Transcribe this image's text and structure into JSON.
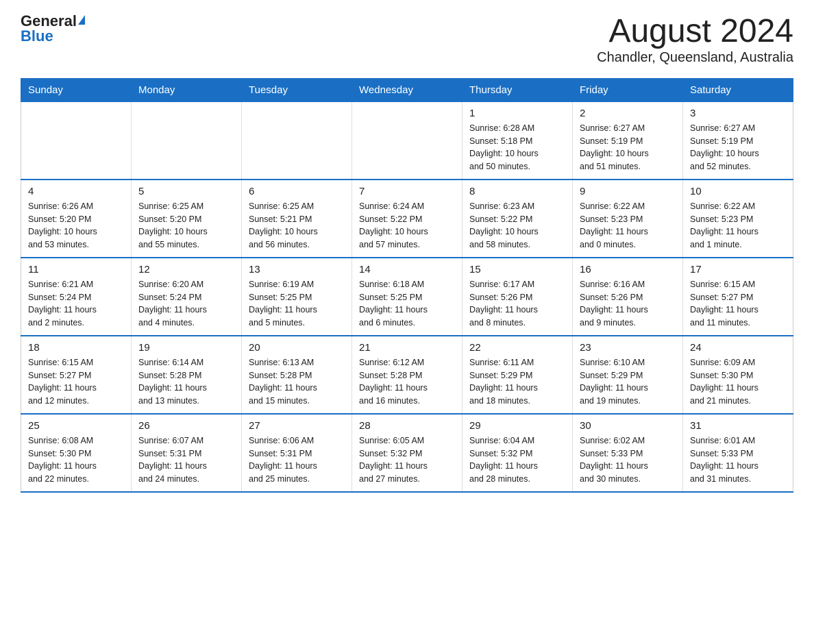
{
  "logo": {
    "general": "General",
    "blue": "Blue"
  },
  "header": {
    "month": "August 2024",
    "location": "Chandler, Queensland, Australia"
  },
  "weekdays": [
    "Sunday",
    "Monday",
    "Tuesday",
    "Wednesday",
    "Thursday",
    "Friday",
    "Saturday"
  ],
  "weeks": [
    [
      {
        "day": "",
        "info": ""
      },
      {
        "day": "",
        "info": ""
      },
      {
        "day": "",
        "info": ""
      },
      {
        "day": "",
        "info": ""
      },
      {
        "day": "1",
        "info": "Sunrise: 6:28 AM\nSunset: 5:18 PM\nDaylight: 10 hours\nand 50 minutes."
      },
      {
        "day": "2",
        "info": "Sunrise: 6:27 AM\nSunset: 5:19 PM\nDaylight: 10 hours\nand 51 minutes."
      },
      {
        "day": "3",
        "info": "Sunrise: 6:27 AM\nSunset: 5:19 PM\nDaylight: 10 hours\nand 52 minutes."
      }
    ],
    [
      {
        "day": "4",
        "info": "Sunrise: 6:26 AM\nSunset: 5:20 PM\nDaylight: 10 hours\nand 53 minutes."
      },
      {
        "day": "5",
        "info": "Sunrise: 6:25 AM\nSunset: 5:20 PM\nDaylight: 10 hours\nand 55 minutes."
      },
      {
        "day": "6",
        "info": "Sunrise: 6:25 AM\nSunset: 5:21 PM\nDaylight: 10 hours\nand 56 minutes."
      },
      {
        "day": "7",
        "info": "Sunrise: 6:24 AM\nSunset: 5:22 PM\nDaylight: 10 hours\nand 57 minutes."
      },
      {
        "day": "8",
        "info": "Sunrise: 6:23 AM\nSunset: 5:22 PM\nDaylight: 10 hours\nand 58 minutes."
      },
      {
        "day": "9",
        "info": "Sunrise: 6:22 AM\nSunset: 5:23 PM\nDaylight: 11 hours\nand 0 minutes."
      },
      {
        "day": "10",
        "info": "Sunrise: 6:22 AM\nSunset: 5:23 PM\nDaylight: 11 hours\nand 1 minute."
      }
    ],
    [
      {
        "day": "11",
        "info": "Sunrise: 6:21 AM\nSunset: 5:24 PM\nDaylight: 11 hours\nand 2 minutes."
      },
      {
        "day": "12",
        "info": "Sunrise: 6:20 AM\nSunset: 5:24 PM\nDaylight: 11 hours\nand 4 minutes."
      },
      {
        "day": "13",
        "info": "Sunrise: 6:19 AM\nSunset: 5:25 PM\nDaylight: 11 hours\nand 5 minutes."
      },
      {
        "day": "14",
        "info": "Sunrise: 6:18 AM\nSunset: 5:25 PM\nDaylight: 11 hours\nand 6 minutes."
      },
      {
        "day": "15",
        "info": "Sunrise: 6:17 AM\nSunset: 5:26 PM\nDaylight: 11 hours\nand 8 minutes."
      },
      {
        "day": "16",
        "info": "Sunrise: 6:16 AM\nSunset: 5:26 PM\nDaylight: 11 hours\nand 9 minutes."
      },
      {
        "day": "17",
        "info": "Sunrise: 6:15 AM\nSunset: 5:27 PM\nDaylight: 11 hours\nand 11 minutes."
      }
    ],
    [
      {
        "day": "18",
        "info": "Sunrise: 6:15 AM\nSunset: 5:27 PM\nDaylight: 11 hours\nand 12 minutes."
      },
      {
        "day": "19",
        "info": "Sunrise: 6:14 AM\nSunset: 5:28 PM\nDaylight: 11 hours\nand 13 minutes."
      },
      {
        "day": "20",
        "info": "Sunrise: 6:13 AM\nSunset: 5:28 PM\nDaylight: 11 hours\nand 15 minutes."
      },
      {
        "day": "21",
        "info": "Sunrise: 6:12 AM\nSunset: 5:28 PM\nDaylight: 11 hours\nand 16 minutes."
      },
      {
        "day": "22",
        "info": "Sunrise: 6:11 AM\nSunset: 5:29 PM\nDaylight: 11 hours\nand 18 minutes."
      },
      {
        "day": "23",
        "info": "Sunrise: 6:10 AM\nSunset: 5:29 PM\nDaylight: 11 hours\nand 19 minutes."
      },
      {
        "day": "24",
        "info": "Sunrise: 6:09 AM\nSunset: 5:30 PM\nDaylight: 11 hours\nand 21 minutes."
      }
    ],
    [
      {
        "day": "25",
        "info": "Sunrise: 6:08 AM\nSunset: 5:30 PM\nDaylight: 11 hours\nand 22 minutes."
      },
      {
        "day": "26",
        "info": "Sunrise: 6:07 AM\nSunset: 5:31 PM\nDaylight: 11 hours\nand 24 minutes."
      },
      {
        "day": "27",
        "info": "Sunrise: 6:06 AM\nSunset: 5:31 PM\nDaylight: 11 hours\nand 25 minutes."
      },
      {
        "day": "28",
        "info": "Sunrise: 6:05 AM\nSunset: 5:32 PM\nDaylight: 11 hours\nand 27 minutes."
      },
      {
        "day": "29",
        "info": "Sunrise: 6:04 AM\nSunset: 5:32 PM\nDaylight: 11 hours\nand 28 minutes."
      },
      {
        "day": "30",
        "info": "Sunrise: 6:02 AM\nSunset: 5:33 PM\nDaylight: 11 hours\nand 30 minutes."
      },
      {
        "day": "31",
        "info": "Sunrise: 6:01 AM\nSunset: 5:33 PM\nDaylight: 11 hours\nand 31 minutes."
      }
    ]
  ]
}
